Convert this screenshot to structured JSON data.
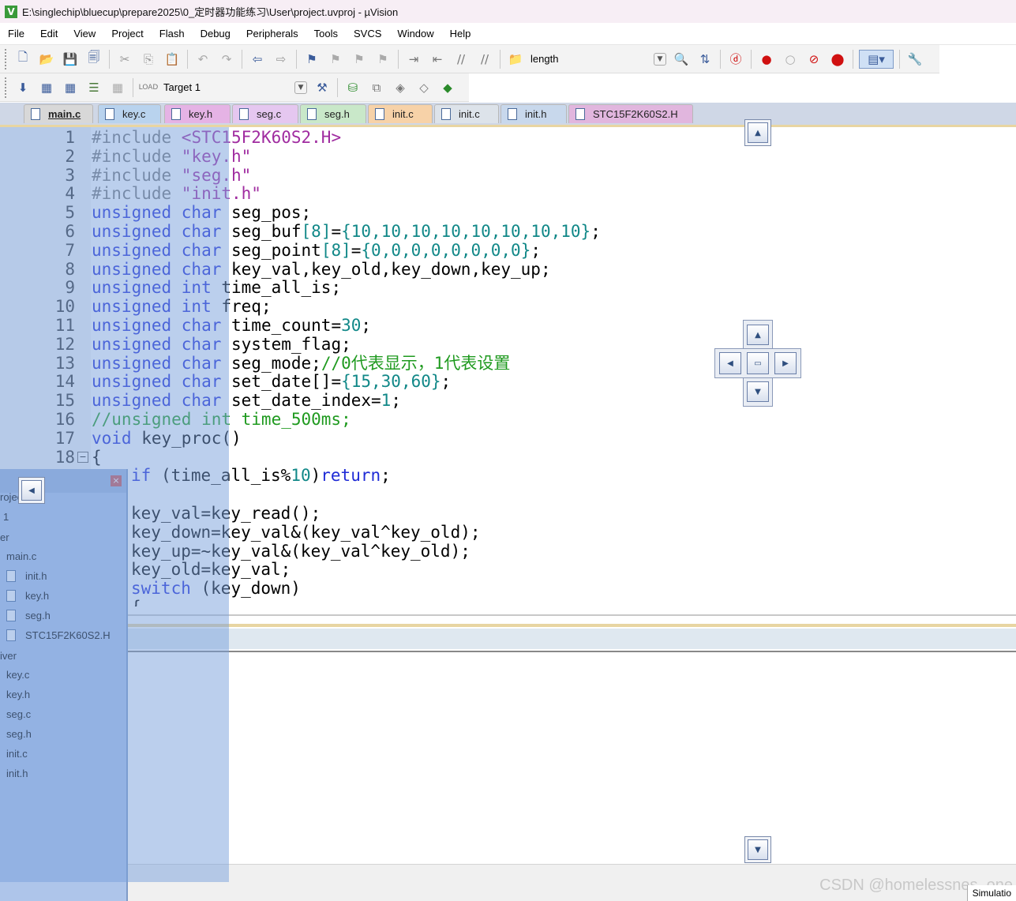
{
  "window": {
    "title": "E:\\singlechip\\bluecup\\prepare2025\\0_定时器功能练习\\User\\project.uvproj - µVision",
    "app_icon": "V"
  },
  "menu": [
    "File",
    "Edit",
    "View",
    "Project",
    "Flash",
    "Debug",
    "Peripherals",
    "Tools",
    "SVCS",
    "Window",
    "Help"
  ],
  "toolbar": {
    "find_value": "length",
    "target_value": "Target 1"
  },
  "tabs": [
    "main.c",
    "key.c",
    "key.h",
    "seg.c",
    "seg.h",
    "init.c",
    "init.c",
    "init.h",
    "STC15F2K60S2.H"
  ],
  "tab_colors": [
    "#d8d8d8",
    "#b9d3ee",
    "#e5b3e5",
    "#e5c7f0",
    "#c9e8c9",
    "#f7d2a8",
    "#dde3ea",
    "#c8d8ec",
    "#e1b6de"
  ],
  "code_lines": [
    {
      "n": "1",
      "segs": [
        [
          "pp",
          "#include "
        ],
        [
          "str",
          "<STC15F2K60S2.H>"
        ]
      ]
    },
    {
      "n": "2",
      "segs": [
        [
          "pp",
          "#include "
        ],
        [
          "str",
          "\"key.h\""
        ]
      ]
    },
    {
      "n": "3",
      "segs": [
        [
          "pp",
          "#include "
        ],
        [
          "str",
          "\"seg.h\""
        ]
      ]
    },
    {
      "n": "4",
      "segs": [
        [
          "pp",
          "#include "
        ],
        [
          "str",
          "\"init.h\""
        ]
      ]
    },
    {
      "n": "5",
      "segs": [
        [
          "kw",
          "unsigned char "
        ],
        [
          "",
          "seg_pos;"
        ]
      ]
    },
    {
      "n": "6",
      "segs": [
        [
          "kw",
          "unsigned char "
        ],
        [
          "",
          "seg_buf"
        ],
        [
          "num",
          "[8]"
        ],
        [
          "",
          "="
        ],
        [
          "num",
          "{10,10,10,10,10,10,10,10}"
        ],
        [
          "",
          ";"
        ]
      ]
    },
    {
      "n": "7",
      "segs": [
        [
          "kw",
          "unsigned char "
        ],
        [
          "",
          "seg_point"
        ],
        [
          "num",
          "[8]"
        ],
        [
          "",
          "="
        ],
        [
          "num",
          "{0,0,0,0,0,0,0,0}"
        ],
        [
          "",
          ";"
        ]
      ]
    },
    {
      "n": "8",
      "segs": [
        [
          "kw",
          "unsigned char "
        ],
        [
          "",
          "key_val,key_old,key_down,key_up;"
        ]
      ]
    },
    {
      "n": "9",
      "segs": [
        [
          "kw",
          "unsigned int "
        ],
        [
          "",
          "time_all_is;"
        ]
      ]
    },
    {
      "n": "10",
      "segs": [
        [
          "kw",
          "unsigned int "
        ],
        [
          "",
          "freq;"
        ]
      ]
    },
    {
      "n": "11",
      "segs": [
        [
          "kw",
          "unsigned char "
        ],
        [
          "",
          "time_count="
        ],
        [
          "num",
          "30"
        ],
        [
          "",
          ";"
        ]
      ]
    },
    {
      "n": "12",
      "segs": [
        [
          "kw",
          "unsigned char "
        ],
        [
          "",
          "system_flag;"
        ]
      ]
    },
    {
      "n": "13",
      "segs": [
        [
          "kw",
          "unsigned char "
        ],
        [
          "",
          "seg_mode;"
        ],
        [
          "cm",
          "//0代表显示，1代表设置"
        ]
      ]
    },
    {
      "n": "14",
      "segs": [
        [
          "kw",
          "unsigned char "
        ],
        [
          "",
          "set_date[]="
        ],
        [
          "num",
          "{15,30,60}"
        ],
        [
          "",
          ";"
        ]
      ]
    },
    {
      "n": "15",
      "segs": [
        [
          "kw",
          "unsigned char "
        ],
        [
          "",
          "set_date_index="
        ],
        [
          "num",
          "1"
        ],
        [
          "",
          ";"
        ]
      ]
    },
    {
      "n": "16",
      "segs": [
        [
          "cm",
          "//unsigned int time_500ms;"
        ]
      ]
    },
    {
      "n": "17",
      "segs": [
        [
          "kw",
          "void "
        ],
        [
          "",
          "key_proc()"
        ]
      ]
    },
    {
      "n": "18",
      "segs": [
        [
          "",
          "{"
        ]
      ]
    },
    {
      "n": "",
      "segs": [
        [
          "",
          "  "
        ],
        [
          "kw",
          "if "
        ],
        [
          "",
          "(time_all_is%"
        ],
        [
          "num",
          "10"
        ],
        [
          "",
          ")"
        ],
        [
          "kw",
          "return"
        ],
        [
          "",
          ";"
        ]
      ]
    },
    {
      "n": "",
      "segs": [
        [
          "",
          ""
        ]
      ]
    },
    {
      "n": "",
      "segs": [
        [
          "",
          "  key_val=key_read();"
        ]
      ]
    },
    {
      "n": "",
      "segs": [
        [
          "",
          "  key_down=key_val&(key_val^key_old);"
        ]
      ]
    },
    {
      "n": "",
      "segs": [
        [
          "",
          "  key_up=~key_val&(key_val^key_old);"
        ]
      ]
    },
    {
      "n": "",
      "segs": [
        [
          "",
          "  key_old=key_val;"
        ]
      ]
    },
    {
      "n": "",
      "segs": [
        [
          "",
          "  "
        ],
        [
          "kw",
          "switch "
        ],
        [
          "",
          "(key_down)"
        ]
      ]
    },
    {
      "n": "",
      "segs": [
        [
          "",
          "  {"
        ]
      ]
    }
  ],
  "project_panel": {
    "items": [
      "roject",
      "1",
      "er",
      "main.c",
      "init.h",
      "key.h",
      "seg.h",
      "STC15F2K60S2.H",
      "iver",
      "key.c",
      "key.h",
      "seg.c",
      "seg.h",
      "init.c",
      "init.h"
    ],
    "close_glyph": "×"
  },
  "status": {
    "simulation": "Simulatio"
  },
  "watermark": "CSDN @homelessnes_one"
}
